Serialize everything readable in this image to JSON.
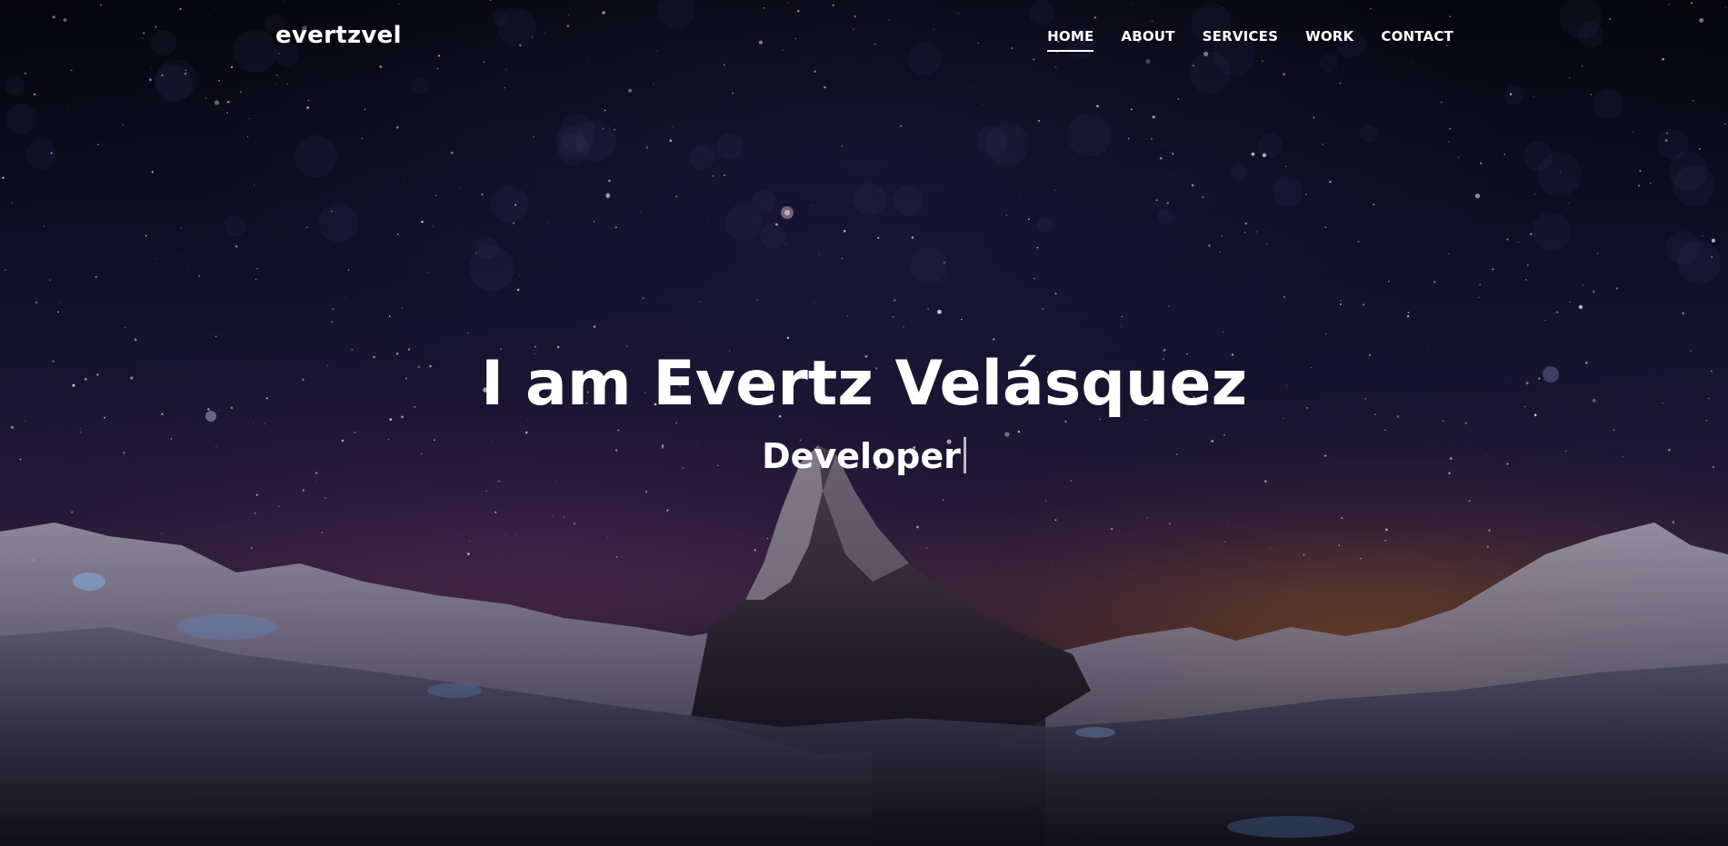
{
  "nav": {
    "brand": "evertzvel",
    "items": [
      {
        "label": "HOME",
        "active": true
      },
      {
        "label": "ABOUT",
        "active": false
      },
      {
        "label": "SERVICES",
        "active": false
      },
      {
        "label": "WORK",
        "active": false
      },
      {
        "label": "CONTACT",
        "active": false
      }
    ]
  },
  "hero": {
    "title": "I am Evertz Velásquez",
    "typed_text": "Developer"
  },
  "colors": {
    "text": "#ffffff",
    "sky_top": "#07070f",
    "sky_horizon_glow": "#c46e28",
    "sky_purple": "#6e326e"
  }
}
